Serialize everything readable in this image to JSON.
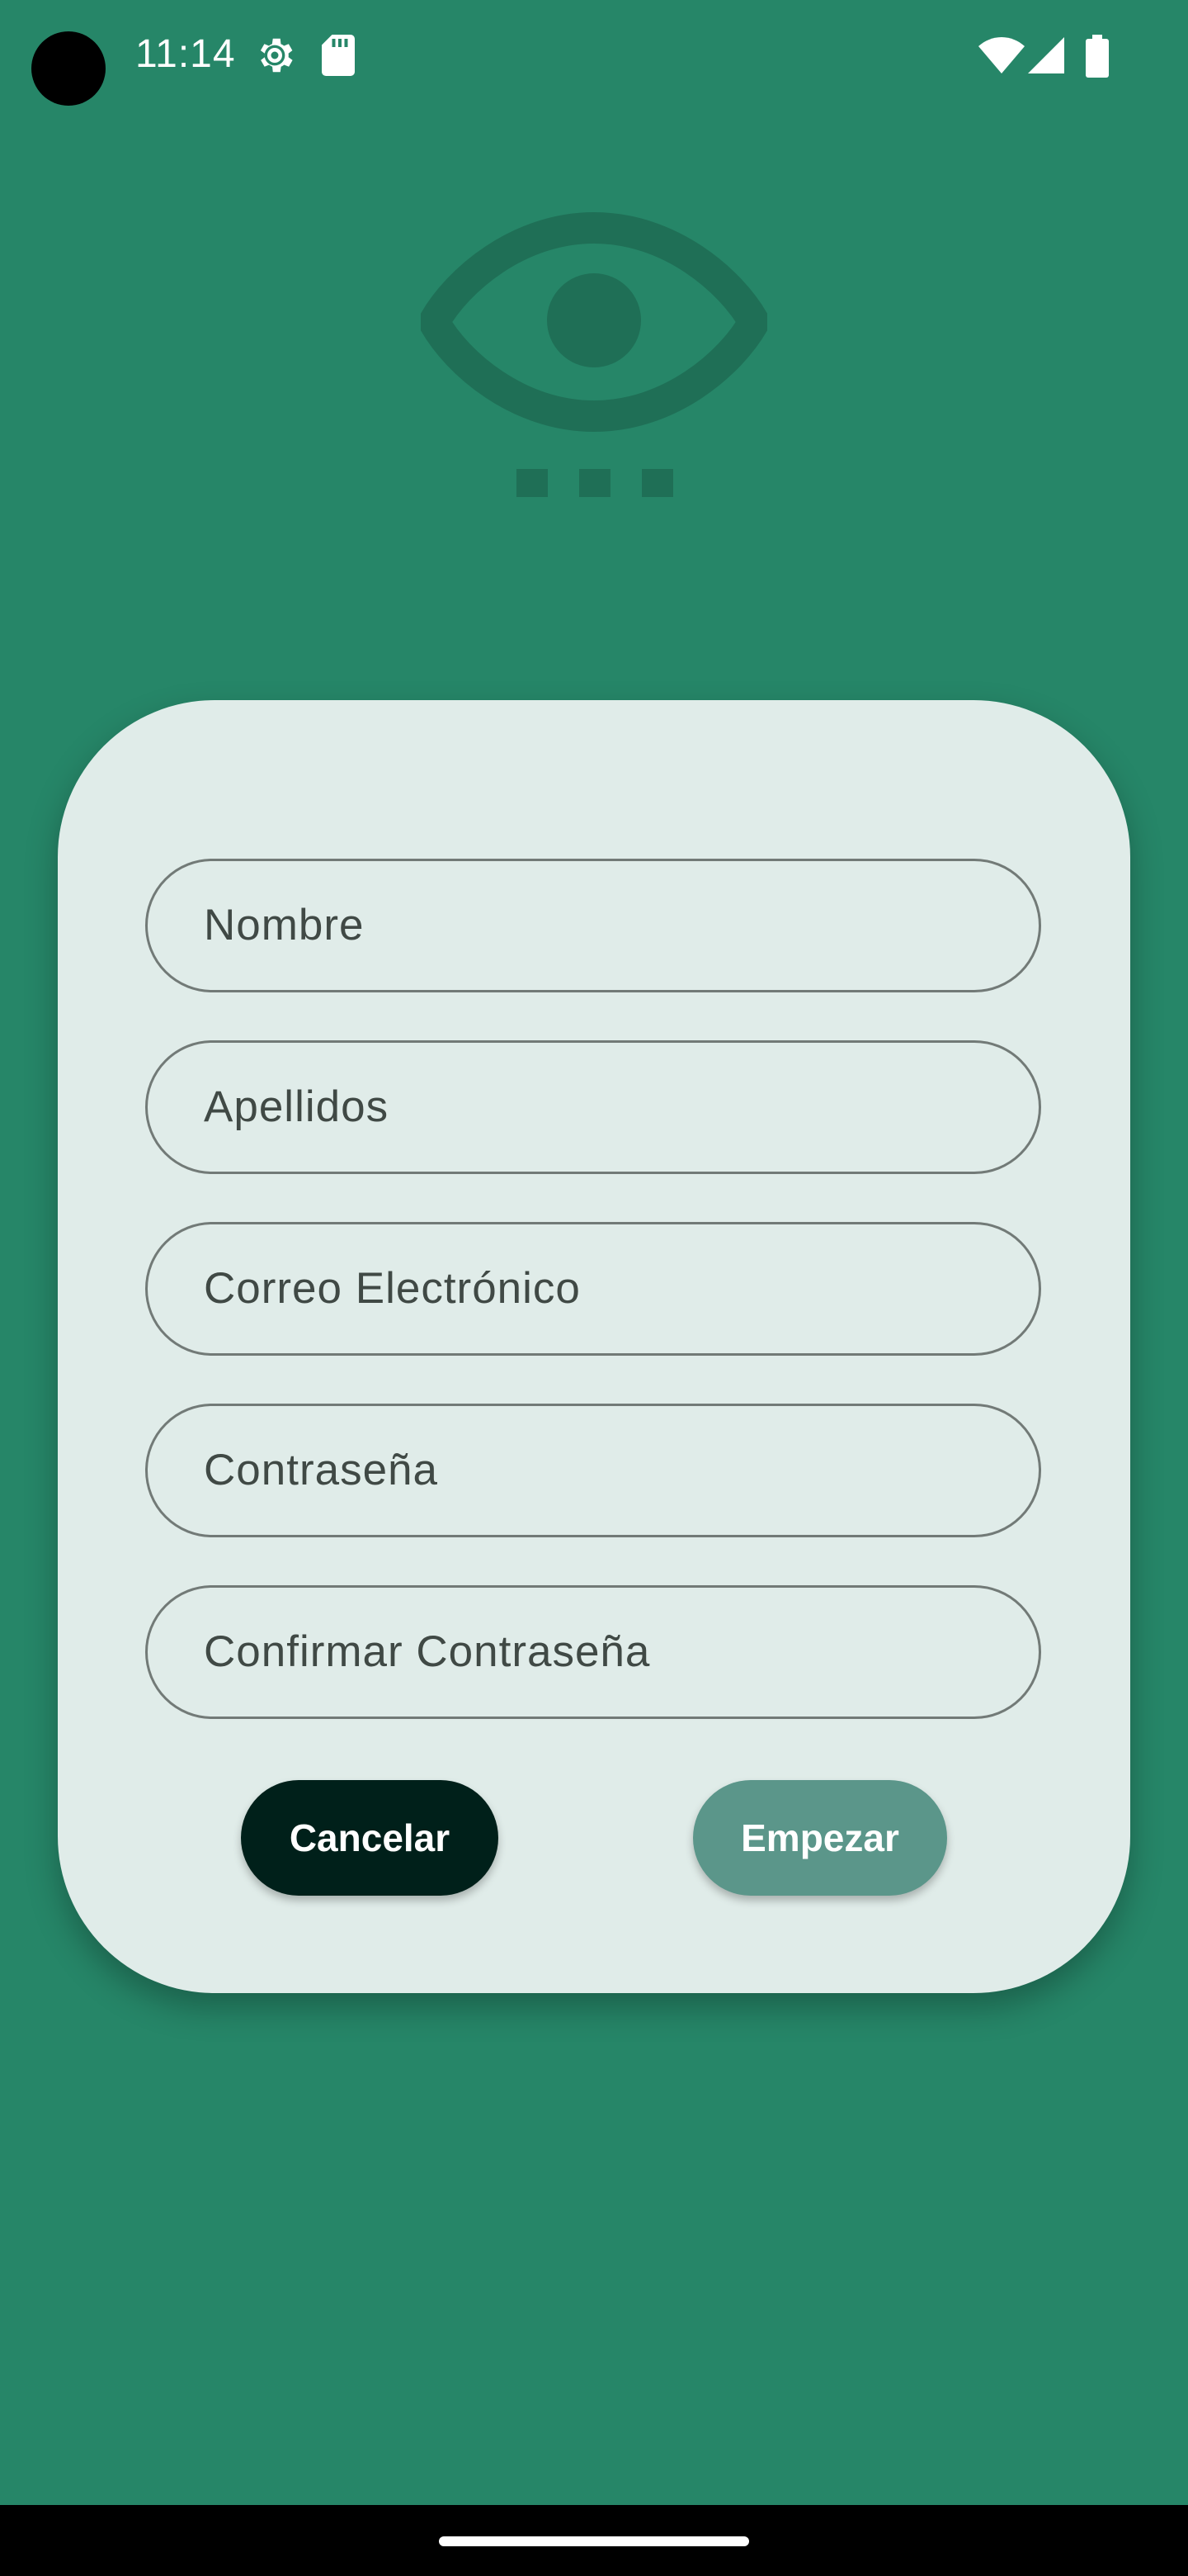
{
  "status_bar": {
    "time": "11:14",
    "icons": [
      "settings-gear-icon",
      "sd-card-icon",
      "wifi-icon",
      "cell-signal-icon",
      "battery-icon"
    ]
  },
  "logo": {
    "icon": "eye-icon",
    "color": "#1f6f56"
  },
  "form": {
    "fields": [
      {
        "label": "Nombre"
      },
      {
        "label": "Apellidos"
      },
      {
        "label": "Correo Electrónico"
      },
      {
        "label": "Contraseña"
      },
      {
        "label": "Confirmar Contraseña"
      }
    ],
    "cancel_label": "Cancelar",
    "start_label": "Empezar"
  },
  "colors": {
    "background": "#268668",
    "card": "#e0ece9",
    "cancel_button": "#00201a",
    "start_button": "#5b968a"
  }
}
